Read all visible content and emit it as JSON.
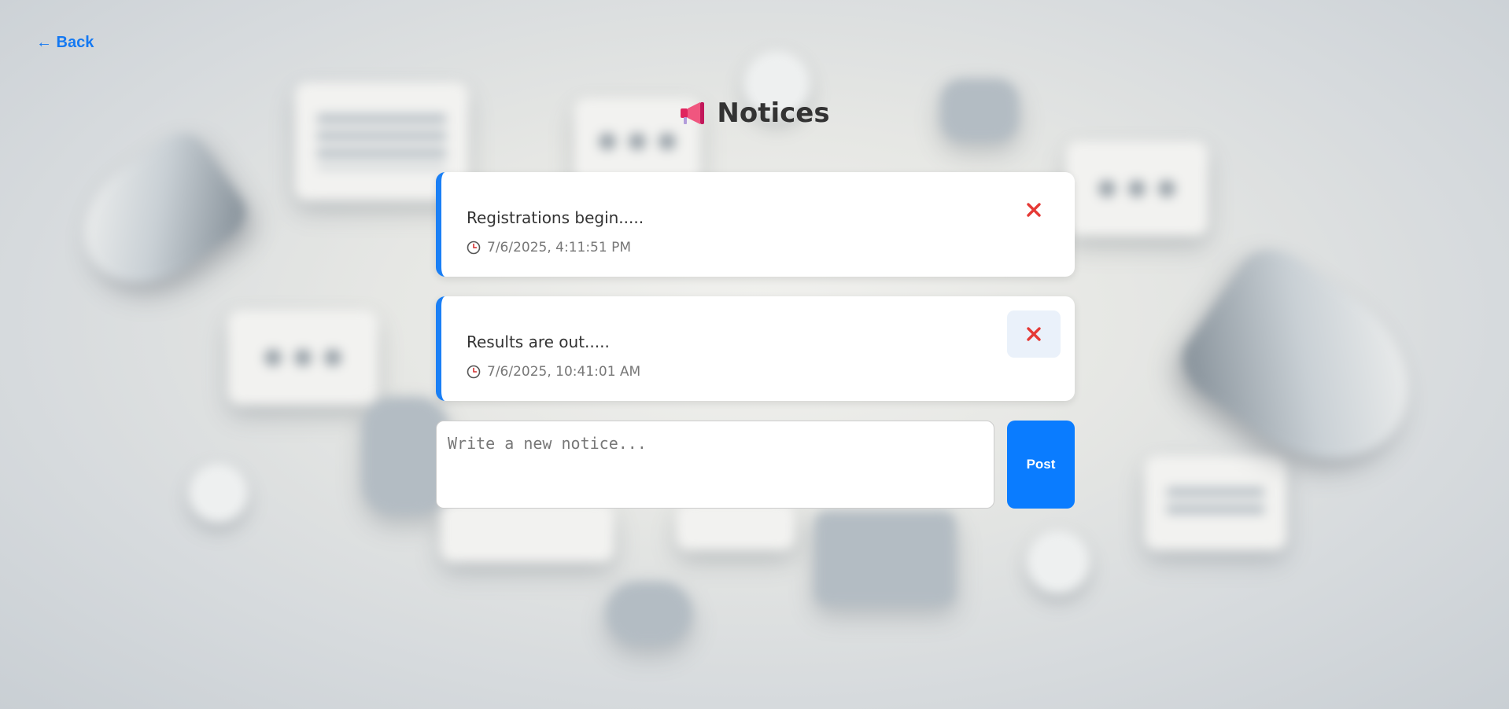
{
  "nav": {
    "back_label": "← Back"
  },
  "header": {
    "title": "Notices",
    "icon": "megaphone-icon"
  },
  "notices": [
    {
      "text": "Registrations begin.....",
      "timestamp": "7/6/2025, 4:11:51 PM",
      "delete_icon": "close-icon"
    },
    {
      "text": "Results are out.....",
      "timestamp": "7/6/2025, 10:41:01 AM",
      "delete_icon": "close-icon"
    }
  ],
  "compose": {
    "placeholder": "Write a new notice...",
    "value": "",
    "post_label": "Post"
  },
  "colors": {
    "accent": "#0a7cff",
    "delete": "#e53935",
    "title": "#333333"
  }
}
